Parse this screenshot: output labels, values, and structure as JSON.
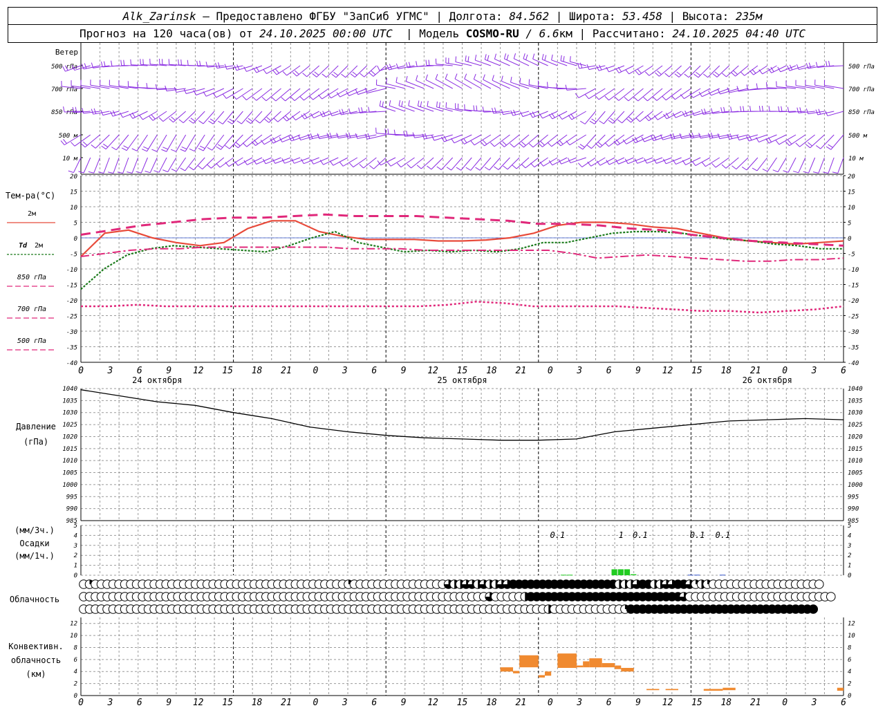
{
  "header": {
    "station": "Alk_Zarinsk",
    "provider": " – Предоставлено ФГБУ \"ЗапСиб УГМС\" | Долгота: ",
    "lon": "84.562",
    "lat_label": " | Широта: ",
    "lat": "53.458",
    "alt_label": " | Высота: ",
    "alt": "235м",
    "forecast_label": "Прогноз на 120 часа(ов) от ",
    "forecast_from": "24.10.2025 00:00 UTC",
    "model_label": "  | Модель ",
    "model": "COSMO-RU",
    "model_res": " / 6.6",
    "model_unit": "км",
    "calc_label": " | Рассчитано: ",
    "calc_time": "24.10.2025 04:40 UTC"
  },
  "colors": {
    "t2m": "#e84a3a",
    "td2m": "#1a7a1a",
    "t850": "#e0287a",
    "t700": "#e0287a",
    "t500": "#e0287a",
    "wind": "#8a2be2",
    "pressure": "#000000",
    "precip_green": "#22cc22",
    "precip_blue": "#3355cc",
    "convective": "#f08a30",
    "grid": "#999999"
  },
  "chart_data": [
    {
      "type": "wind_barbs",
      "title": "Ветер",
      "levels": [
        "500 гПа",
        "700 гПа",
        "850 гПа",
        "500 м",
        "10 м"
      ]
    },
    {
      "type": "line",
      "ylabel": "Тем-ра(°C)",
      "ylim": [
        -40,
        20
      ],
      "yticks": [
        "20",
        "15",
        "10",
        "5",
        "0",
        "-5",
        "-10",
        "-15",
        "-20",
        "-25",
        "-30",
        "-35",
        "-40"
      ],
      "x_ticks": [
        "0",
        "3",
        "6",
        "9",
        "12",
        "15",
        "18",
        "21",
        "0",
        "3",
        "6",
        "9",
        "12",
        "15",
        "18",
        "21",
        "0",
        "3",
        "6",
        "9",
        "12",
        "15",
        "18",
        "21",
        "0",
        "3",
        "6"
      ],
      "day_labels": [
        "24 октября",
        "25 октября",
        "26 октября"
      ],
      "x": [
        0,
        6,
        9,
        12,
        18,
        24,
        27,
        30,
        33,
        36,
        39,
        42,
        48,
        51,
        54,
        57,
        60,
        62,
        64,
        66,
        68,
        70,
        72,
        75,
        78,
        81,
        84,
        87,
        90,
        93,
        96,
        102,
        108,
        114,
        117,
        120
      ],
      "series": [
        {
          "name": "2м",
          "values": [
            -6,
            1.5,
            2.5,
            0,
            -1.5,
            -2.5,
            -1.5,
            3,
            5.5,
            5.5,
            2,
            0.5,
            -0.5,
            -0.5,
            -0.5,
            -1,
            -1,
            -0.7,
            0,
            1.5,
            4,
            5,
            5,
            4.5,
            3.5,
            3,
            1.5,
            0,
            -1,
            -1.5,
            -2,
            -1.5,
            -1
          ]
        },
        {
          "name": "Td 2м",
          "values": [
            -16.5,
            -10,
            -5.5,
            -3.5,
            -2.5,
            -3,
            -3.5,
            -4,
            -4.5,
            -2.5,
            0,
            2,
            -1.5,
            -3,
            -4.5,
            -4,
            -4.5,
            -4,
            -4.5,
            -3.5,
            -1.5,
            -1.5,
            0,
            1.5,
            2,
            2,
            1.5,
            0.5,
            -0.5,
            -1,
            -2,
            -2.5,
            -3.5,
            -3.5
          ]
        },
        {
          "name": "850 гПа",
          "values": [
            -6,
            -5,
            -4,
            -3.5,
            -3.5,
            -3,
            -3,
            -3,
            -3,
            -3,
            -3,
            -3.5,
            -3.5,
            -3.5,
            -4,
            -4,
            -4,
            -4,
            -4,
            -4,
            -5,
            -6.5,
            -6,
            -5.5,
            -6,
            -6.5,
            -7,
            -7.5,
            -7.5,
            -7,
            -7,
            -6.5
          ]
        },
        {
          "name": "700 гПа",
          "values": [
            1,
            2.5,
            4,
            5,
            6,
            6.5,
            6.5,
            7,
            7.5,
            7,
            7,
            7,
            6.5,
            6,
            5.5,
            4.5,
            4.5,
            4,
            3,
            2.5,
            1,
            0,
            -1,
            -1.5,
            -2,
            -2.5
          ]
        },
        {
          "name": "500 гПа",
          "values": [
            -22,
            -22,
            -21.5,
            -22,
            -22,
            -22,
            -22,
            -22,
            -22,
            -22,
            -22,
            -22,
            -22,
            -21.5,
            -20.5,
            -21,
            -22,
            -22,
            -22,
            -22,
            -22.5,
            -23,
            -23.5,
            -23.5,
            -24,
            -23.5,
            -23,
            -22
          ]
        }
      ]
    },
    {
      "type": "line",
      "ylabel": "Давление",
      "yunit": "(гПа)",
      "ylim": [
        985,
        1040
      ],
      "yticks": [
        "1040",
        "1035",
        "1030",
        "1025",
        "1020",
        "1015",
        "1010",
        "1005",
        "1000",
        "995",
        "990",
        "985"
      ],
      "x": [
        0,
        6,
        12,
        18,
        24,
        30,
        36,
        42,
        48,
        54,
        60,
        66,
        72,
        78,
        84,
        90,
        96,
        102,
        108,
        114,
        120
      ],
      "values": [
        1039.5,
        1037,
        1034.5,
        1033,
        1030,
        1027.5,
        1024,
        1022,
        1020.5,
        1019.5,
        1019,
        1018.5,
        1018.5,
        1019,
        1022,
        1023.5,
        1025,
        1026.5,
        1027,
        1027.5,
        1027
      ]
    },
    {
      "type": "bar",
      "ylabel": "Осадки",
      "yunit_3h": "(мм/3ч.)",
      "yunit_1h": "(мм/1ч.)",
      "ylim": [
        0,
        5
      ],
      "yticks": [
        "5",
        "4",
        "3",
        "2",
        "1",
        "0"
      ],
      "totals": [
        {
          "x": 75,
          "label": "0.1"
        },
        {
          "x": 85,
          "label": "1"
        },
        {
          "x": 88,
          "label": "0.1"
        },
        {
          "x": 97,
          "label": "0.1"
        },
        {
          "x": 101,
          "label": "0.1"
        }
      ],
      "bars": [
        {
          "x": 76,
          "value": 0.05,
          "color": "green"
        },
        {
          "x": 77,
          "value": 0.05,
          "color": "green"
        },
        {
          "x": 84,
          "value": 0.6,
          "color": "green"
        },
        {
          "x": 85,
          "value": 0.6,
          "color": "green"
        },
        {
          "x": 86,
          "value": 0.6,
          "color": "green"
        },
        {
          "x": 87,
          "value": 0.1,
          "color": "green"
        },
        {
          "x": 96,
          "value": 0.05,
          "color": "blue"
        },
        {
          "x": 97,
          "value": 0.05,
          "color": "blue"
        },
        {
          "x": 101,
          "value": 0.05,
          "color": "blue"
        }
      ]
    },
    {
      "type": "cloud_symbols",
      "title": "Облачность",
      "rows": [
        {
          "fill": [
            0,
            0.25,
            0,
            0,
            0,
            0,
            0,
            0,
            0,
            0,
            0,
            0,
            0,
            0,
            0,
            0,
            0,
            0,
            0,
            0,
            0,
            0,
            0,
            0,
            0,
            0,
            0,
            0,
            0,
            0,
            0,
            0,
            0,
            0,
            0,
            0,
            0,
            0,
            0,
            0,
            0,
            0,
            0,
            0,
            0,
            0.25,
            0,
            0,
            0,
            0,
            0,
            0,
            0,
            0,
            0,
            0,
            0,
            0,
            0,
            0,
            0,
            0,
            0.75,
            0.5,
            0.5,
            0.75,
            0.75,
            0.5,
            0.75,
            0.5,
            0.5,
            0.75,
            0.75,
            1,
            1,
            1,
            1,
            1,
            1,
            1,
            1,
            1,
            1,
            1,
            1,
            1,
            1,
            1,
            1,
            1,
            1,
            0.5,
            0.5,
            0.5,
            0.75,
            1,
            1,
            0.5,
            0.5,
            0.75,
            0.75,
            1,
            1,
            0.75,
            0.25,
            0.5,
            0.25,
            0,
            0,
            0,
            0,
            0,
            0,
            0,
            0,
            0,
            0,
            0,
            0,
            0,
            0,
            0,
            0,
            0,
            0,
            0
          ]
        },
        {
          "fill": [
            0,
            0,
            0,
            0,
            0,
            0,
            0,
            0,
            0,
            0,
            0,
            0,
            0,
            0,
            0,
            0,
            0,
            0,
            0,
            0,
            0,
            0,
            0,
            0,
            0,
            0,
            0,
            0,
            0,
            0,
            0,
            0,
            0,
            0,
            0,
            0,
            0,
            0,
            0,
            0,
            0,
            0,
            0,
            0,
            0,
            0,
            0,
            0,
            0,
            0,
            0,
            0,
            0,
            0,
            0,
            0,
            0,
            0,
            0,
            0,
            0,
            0,
            0,
            0,
            0,
            0,
            0,
            0,
            0,
            0.75,
            0,
            0,
            0,
            0,
            0,
            0.5,
            1,
            1,
            1,
            1,
            1,
            1,
            1,
            1,
            1,
            1,
            1,
            1,
            1,
            1,
            1,
            1,
            1,
            1,
            1,
            1,
            1,
            1,
            1,
            1,
            1,
            1,
            0.75,
            0,
            0,
            0,
            0,
            0,
            0,
            0,
            0,
            0,
            0,
            0,
            0,
            0,
            0,
            0,
            0,
            0,
            0,
            0,
            0,
            0,
            0,
            0,
            0,
            0
          ]
        },
        {
          "fill": [
            0,
            0,
            0,
            0,
            0,
            0,
            0,
            0,
            0,
            0,
            0,
            0,
            0,
            0,
            0,
            0,
            0,
            0,
            0,
            0,
            0,
            0,
            0,
            0,
            0,
            0,
            0,
            0,
            0,
            0,
            0,
            0,
            0,
            0,
            0,
            0,
            0,
            0,
            0,
            0,
            0,
            0,
            0,
            0,
            0,
            0,
            0,
            0,
            0,
            0,
            0,
            0,
            0,
            0,
            0,
            0,
            0,
            0,
            0,
            0,
            0,
            0,
            0,
            0,
            0,
            0,
            0,
            0,
            0,
            0,
            0,
            0,
            0,
            0,
            0,
            0,
            0,
            0,
            0,
            0.5,
            0,
            0,
            0,
            0,
            0,
            0,
            0,
            0,
            0,
            0,
            0,
            0,
            0.25,
            1,
            1,
            1,
            1,
            1,
            1,
            1,
            1,
            1,
            1,
            1,
            1,
            1,
            1,
            1,
            1,
            1,
            1,
            1,
            1,
            1,
            1,
            1,
            1,
            1,
            1,
            1,
            1,
            1,
            1,
            1,
            1
          ]
        }
      ]
    },
    {
      "type": "bar",
      "ylabel": "Конвективн.",
      "ylabel2": "облачность",
      "yunit": "(км)",
      "ylim": [
        0,
        13
      ],
      "yticks": [
        "12",
        "10",
        "8",
        "6",
        "4",
        "2",
        "0"
      ],
      "bars": [
        {
          "x0": 66,
          "x1": 68,
          "bottom": 4.0,
          "top": 4.7
        },
        {
          "x0": 68,
          "x1": 69,
          "bottom": 3.7,
          "top": 4.1
        },
        {
          "x0": 69,
          "x1": 72,
          "bottom": 4.7,
          "top": 6.7
        },
        {
          "x0": 72,
          "x1": 73,
          "bottom": 3.0,
          "top": 3.4
        },
        {
          "x0": 73,
          "x1": 74,
          "bottom": 3.3,
          "top": 4.0
        },
        {
          "x0": 75,
          "x1": 78,
          "bottom": 4.6,
          "top": 7.0
        },
        {
          "x0": 78,
          "x1": 79,
          "bottom": 4.7,
          "top": 5.0
        },
        {
          "x0": 79,
          "x1": 80,
          "bottom": 4.7,
          "top": 5.7
        },
        {
          "x0": 80,
          "x1": 82,
          "bottom": 4.7,
          "top": 6.2
        },
        {
          "x0": 82,
          "x1": 84,
          "bottom": 4.7,
          "top": 5.4
        },
        {
          "x0": 84,
          "x1": 85,
          "bottom": 4.4,
          "top": 5.0
        },
        {
          "x0": 85,
          "x1": 87,
          "bottom": 4.0,
          "top": 4.6
        },
        {
          "x0": 89,
          "x1": 91,
          "bottom": 0.9,
          "top": 1.1
        },
        {
          "x0": 92,
          "x1": 94,
          "bottom": 0.9,
          "top": 1.1
        },
        {
          "x0": 98,
          "x1": 101,
          "bottom": 0.8,
          "top": 1.1
        },
        {
          "x0": 101,
          "x1": 103,
          "bottom": 0.9,
          "top": 1.3
        },
        {
          "x0": 119,
          "x1": 120,
          "bottom": 0.8,
          "top": 1.3
        }
      ]
    }
  ]
}
